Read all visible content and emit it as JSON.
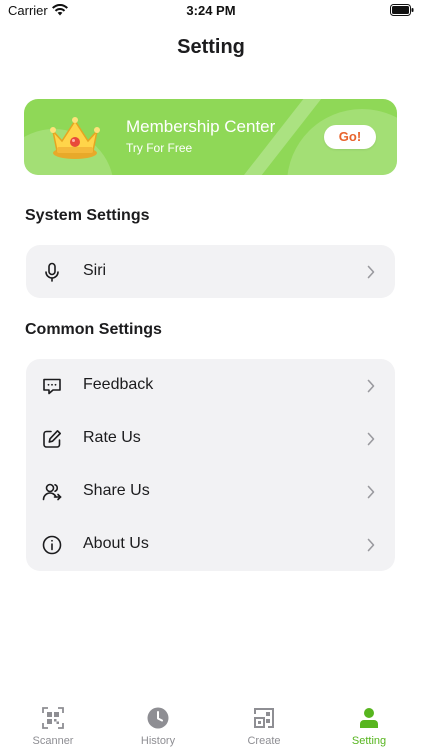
{
  "status_bar": {
    "carrier": "Carrier",
    "time": "3:24 PM"
  },
  "header": {
    "title": "Setting"
  },
  "banner": {
    "title": "Membership Center",
    "subtitle": "Try For Free",
    "button_label": "Go!",
    "accent_color": "#8fd857",
    "button_text_color": "#e8632c",
    "icon": "crown-icon"
  },
  "sections": {
    "system": {
      "heading": "System Settings",
      "items": [
        {
          "label": "Siri",
          "icon": "microphone-icon"
        }
      ]
    },
    "common": {
      "heading": "Common Settings",
      "items": [
        {
          "label": "Feedback",
          "icon": "message-icon"
        },
        {
          "label": "Rate Us",
          "icon": "edit-icon"
        },
        {
          "label": "Share Us",
          "icon": "share-users-icon"
        },
        {
          "label": "About Us",
          "icon": "info-icon"
        }
      ]
    }
  },
  "tab_bar": {
    "active_color": "#57b51f",
    "inactive_color": "#8e8e93",
    "tabs": [
      {
        "label": "Scanner",
        "icon": "qr-scan-icon",
        "active": false
      },
      {
        "label": "History",
        "icon": "clock-icon",
        "active": false
      },
      {
        "label": "Create",
        "icon": "qr-create-icon",
        "active": false
      },
      {
        "label": "Setting",
        "icon": "person-icon",
        "active": true
      }
    ]
  }
}
